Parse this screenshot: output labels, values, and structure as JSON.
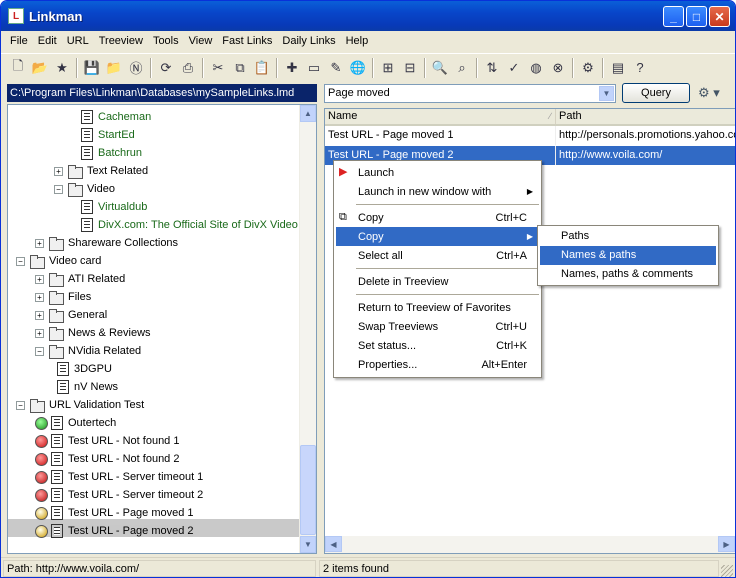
{
  "window": {
    "title": "Linkman",
    "app_icon": "L"
  },
  "menu": [
    "File",
    "Edit",
    "URL",
    "Treeview",
    "Tools",
    "View",
    "Fast Links",
    "Daily Links",
    "Help"
  ],
  "toolbar_icons": [
    "new-icon",
    "open-icon",
    "favorite-icon",
    "save-icon",
    "folder-icon",
    "netscape-icon",
    "import-icon",
    "print-icon",
    "cut-icon",
    "copy-icon",
    "paste-icon",
    "add-url-icon",
    "add-folder-icon",
    "edit-icon",
    "browse-icon",
    "expand-icon",
    "collapse-icon",
    "find-icon",
    "find-dup-icon",
    "sort-icon",
    "check-icon",
    "globe-icon",
    "stop-icon",
    "options-icon",
    "view-icon",
    "help-icon"
  ],
  "database_path": "C:\\Program Files\\Linkman\\Databases\\mySampleLinks.lmd",
  "tree": [
    {
      "label": "Cacheman",
      "type": "doc",
      "color": "green"
    },
    {
      "label": "StartEd",
      "type": "doc",
      "color": "green"
    },
    {
      "label": "Batchrun",
      "type": "doc",
      "color": "green"
    },
    {
      "label": "Text Related",
      "type": "folder",
      "expander": "+",
      "color": "black"
    },
    {
      "label": "Video",
      "type": "folder-open",
      "expander": "−",
      "color": "black"
    },
    {
      "label": "Virtualdub",
      "type": "doc",
      "color": "green"
    },
    {
      "label": "DivX.com: The Official Site of DivX Video",
      "type": "doc",
      "color": "green"
    },
    {
      "label": "Shareware Collections",
      "type": "folder",
      "expander": "+",
      "color": "black"
    },
    {
      "label": "Video card",
      "type": "folder-open",
      "expander": "−",
      "color": "black"
    },
    {
      "label": "ATI Related",
      "type": "folder",
      "expander": "+",
      "color": "black"
    },
    {
      "label": "Files",
      "type": "folder",
      "expander": "+",
      "color": "black"
    },
    {
      "label": "General",
      "type": "folder",
      "expander": "+",
      "color": "black"
    },
    {
      "label": "News & Reviews",
      "type": "folder",
      "expander": "+",
      "color": "black"
    },
    {
      "label": "NVidia Related",
      "type": "folder-open",
      "expander": "−",
      "color": "black"
    },
    {
      "label": "3DGPU",
      "type": "doc",
      "color": "black"
    },
    {
      "label": "nV News",
      "type": "doc",
      "color": "black"
    },
    {
      "label": "URL Validation Test",
      "type": "folder-open",
      "expander": "−",
      "color": "black"
    },
    {
      "label": "Outertech",
      "type": "doc",
      "status": "green",
      "color": "black"
    },
    {
      "label": "Test URL - Not found 1",
      "type": "doc",
      "status": "red",
      "color": "black"
    },
    {
      "label": "Test URL - Not found 2",
      "type": "doc",
      "status": "red",
      "color": "black"
    },
    {
      "label": "Test URL - Server timeout 1",
      "type": "doc",
      "status": "redx",
      "color": "black"
    },
    {
      "label": "Test URL - Server timeout 2",
      "type": "doc",
      "status": "redx",
      "color": "black"
    },
    {
      "label": "Test URL - Page moved 1",
      "type": "doc",
      "status": "yellow",
      "color": "black"
    },
    {
      "label": "Test URL - Page moved 2",
      "type": "doc",
      "status": "yellow",
      "color": "black",
      "selected": true
    }
  ],
  "query": {
    "value": "Page moved",
    "button": "Query"
  },
  "list": {
    "columns": [
      "Name",
      "Path"
    ],
    "rows": [
      {
        "name": "Test URL - Page moved 1",
        "path": "http://personals.promotions.yahoo.com"
      },
      {
        "name": "Test URL - Page moved 2",
        "path": "http://www.voila.com/",
        "selected": true
      }
    ]
  },
  "context_menu": [
    {
      "label": "Launch",
      "icon": "launch-icon"
    },
    {
      "label": "Launch in new window with",
      "submenu": true
    },
    {
      "sep": true
    },
    {
      "label": "Copy",
      "shortcut": "Ctrl+C",
      "icon": "copy-icon"
    },
    {
      "label": "Copy",
      "submenu": true,
      "highlighted": true
    },
    {
      "label": "Select all",
      "shortcut": "Ctrl+A"
    },
    {
      "sep": true
    },
    {
      "label": "Delete in Treeview"
    },
    {
      "sep": true
    },
    {
      "label": "Return to Treeview of Favorites"
    },
    {
      "label": "Swap Treeviews",
      "shortcut": "Ctrl+U"
    },
    {
      "label": "Set status...",
      "shortcut": "Ctrl+K"
    },
    {
      "label": "Properties...",
      "shortcut": "Alt+Enter"
    }
  ],
  "submenu": [
    {
      "label": "Paths"
    },
    {
      "label": "Names & paths",
      "highlighted": true
    },
    {
      "label": "Names, paths & comments"
    }
  ],
  "status": {
    "path": "Path: http://www.voila.com/",
    "count": "2 items found"
  },
  "colors": {
    "selection": "#316ac5",
    "title_bar": "#0845c9",
    "tree_green": "#1a6a1a"
  }
}
